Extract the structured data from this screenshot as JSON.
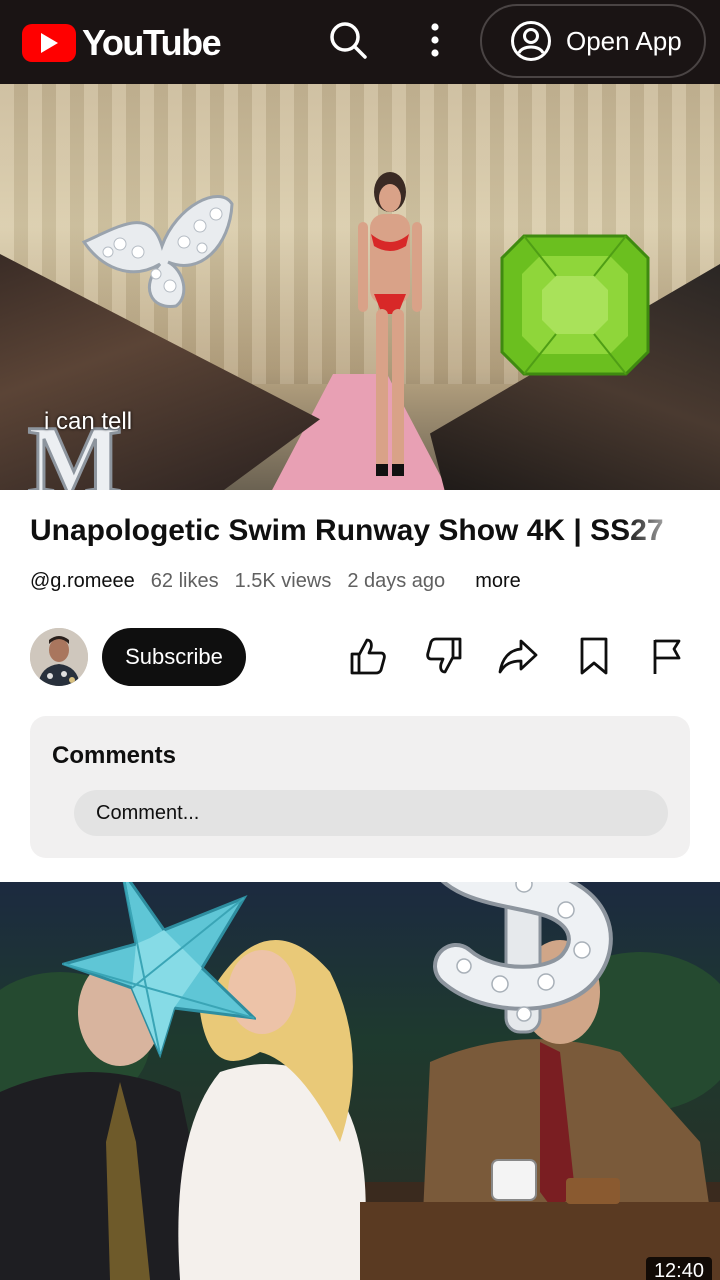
{
  "header": {
    "logo_text": "YouTube",
    "open_app_label": "Open App"
  },
  "player": {
    "overlay_text": "i can tell",
    "overlay_letter": "M"
  },
  "video": {
    "title": "Unapologetic Swim Runway Show 4K | SS27",
    "channel": "@g.romeee",
    "likes": "62 likes",
    "views": "1.5K views",
    "age": "2 days ago",
    "more_label": "more"
  },
  "actions": {
    "subscribe_label": "Subscribe"
  },
  "comments": {
    "title": "Comments",
    "placeholder": "Comment..."
  },
  "next_video": {
    "duration": "12:40"
  },
  "colors": {
    "header_bg": "#1a1414",
    "brand_red": "#ff0000",
    "subscribe_bg": "#0f0f0f",
    "comments_bg": "#f1f0f0"
  },
  "icons": [
    "youtube-logo-icon",
    "search-icon",
    "more-vert-icon",
    "account-icon",
    "like-icon",
    "dislike-icon",
    "share-icon",
    "save-icon",
    "report-flag-icon"
  ]
}
